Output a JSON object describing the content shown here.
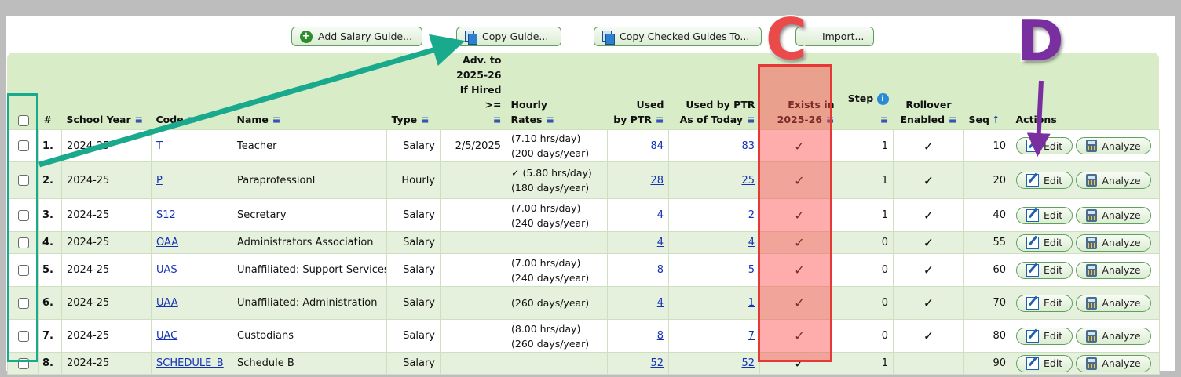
{
  "toolbar": {
    "add_label": "Add Salary Guide...",
    "copy_label": "Copy Guide...",
    "copy_checked_label": "Copy Checked Guides To...",
    "import_label": "Import..."
  },
  "headers": {
    "num": "#",
    "school_year": "School Year",
    "code": "Code",
    "name": "Name",
    "type": "Type",
    "adv_line1": "Adv. to",
    "adv_line2": "2025-26",
    "adv_line3": "If Hired >=",
    "rates_line1": "Hourly",
    "rates_line2": "Rates",
    "used_line1": "Used",
    "used_line2": "by PTR",
    "used_today_line1": "Used by PTR",
    "used_today_line2": "As of Today",
    "exists_line1": "Exists in",
    "exists_line2": "2025-26",
    "step": "Step",
    "rollover_line1": "Rollover",
    "rollover_line2": "Enabled",
    "seq": "Seq",
    "actions": "Actions"
  },
  "icons": {
    "menu": "≡",
    "sort_up": "↑",
    "info": "i",
    "check": "✓"
  },
  "buttons": {
    "edit": "Edit",
    "analyze": "Analyze"
  },
  "rows": [
    {
      "num": "1.",
      "year": "2024-25",
      "code": "T",
      "name": "Teacher",
      "type": "Salary",
      "adv": "2/5/2025",
      "rate1": "(7.10 hrs/day)",
      "rate2": "(200 days/year)",
      "used": "84",
      "used_today": "83",
      "exists": "✓",
      "step": "1",
      "rollover": "✓",
      "seq": "10"
    },
    {
      "num": "2.",
      "year": "2024-25",
      "code": "P",
      "name": "Paraprofessionl",
      "type": "Hourly",
      "adv": "",
      "rate1": "✓ (5.80 hrs/day)",
      "rate2": "(180 days/year)",
      "used": "28",
      "used_today": "25",
      "exists": "✓",
      "step": "1",
      "rollover": "✓",
      "seq": "20"
    },
    {
      "num": "3.",
      "year": "2024-25",
      "code": "S12",
      "name": "Secretary",
      "type": "Salary",
      "adv": "",
      "rate1": "(7.00 hrs/day)",
      "rate2": "(240 days/year)",
      "used": "4",
      "used_today": "2",
      "exists": "✓",
      "step": "1",
      "rollover": "✓",
      "seq": "40"
    },
    {
      "num": "4.",
      "year": "2024-25",
      "code": "OAA",
      "name": "Administrators Association",
      "type": "Salary",
      "adv": "",
      "rate1": "",
      "rate2": "",
      "used": "4",
      "used_today": "4",
      "exists": "✓",
      "step": "0",
      "rollover": "✓",
      "seq": "55"
    },
    {
      "num": "5.",
      "year": "2024-25",
      "code": "UAS",
      "name": "Unaffiliated: Support Services",
      "type": "Salary",
      "adv": "",
      "rate1": "(7.00 hrs/day)",
      "rate2": "(240 days/year)",
      "used": "8",
      "used_today": "5",
      "exists": "✓",
      "step": "0",
      "rollover": "✓",
      "seq": "60"
    },
    {
      "num": "6.",
      "year": "2024-25",
      "code": "UAA",
      "name": "Unaffiliated: Administration",
      "type": "Salary",
      "adv": "",
      "rate1": "",
      "rate2": "(260 days/year)",
      "used": "4",
      "used_today": "1",
      "exists": "✓",
      "step": "0",
      "rollover": "✓",
      "seq": "70"
    },
    {
      "num": "7.",
      "year": "2024-25",
      "code": "UAC",
      "name": "Custodians",
      "type": "Salary",
      "adv": "",
      "rate1": "(8.00 hrs/day)",
      "rate2": "(260 days/year)",
      "used": "8",
      "used_today": "7",
      "exists": "✓",
      "step": "0",
      "rollover": "✓",
      "seq": "80"
    },
    {
      "num": "8.",
      "year": "2024-25",
      "code": "SCHEDULE_B",
      "name": "Schedule B",
      "type": "Salary",
      "adv": "",
      "rate1": "",
      "rate2": "",
      "used": "52",
      "used_today": "52",
      "exists": "✓",
      "step": "1",
      "rollover": "",
      "seq": "90"
    }
  ],
  "annotations": {
    "letter_c": "C",
    "letter_d": "D"
  },
  "colors": {
    "header_bg": "#d8ecc8",
    "row_alt": "#e5f1dc",
    "highlight_red": "#e53935",
    "highlight_teal": "#19a98c",
    "arrow_teal": "#19a98c",
    "arrow_purple": "#7a2fa0",
    "link": "#1432b4"
  }
}
